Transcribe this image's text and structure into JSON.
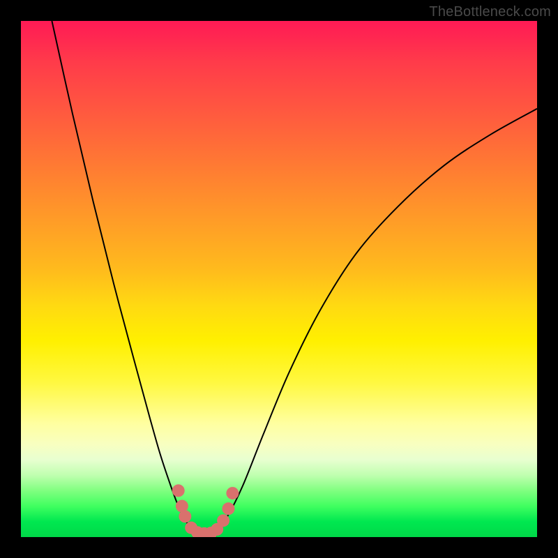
{
  "watermark": "TheBottleneck.com",
  "chart_data": {
    "type": "line",
    "title": "",
    "xlabel": "",
    "ylabel": "",
    "xlim": [
      0,
      100
    ],
    "ylim": [
      0,
      100
    ],
    "grid": false,
    "legend": false,
    "series": [
      {
        "name": "left-branch",
        "x": [
          6,
          10,
          14,
          18,
          22,
          25,
          27,
          29,
          30.5,
          32,
          33.5
        ],
        "y": [
          100,
          82,
          65,
          49,
          34,
          23,
          16,
          10,
          6,
          3,
          1.5
        ]
      },
      {
        "name": "right-branch",
        "x": [
          38,
          40,
          43,
          47,
          52,
          58,
          65,
          73,
          82,
          91,
          100
        ],
        "y": [
          1.5,
          4,
          10,
          20,
          32,
          44,
          55,
          64,
          72,
          78,
          83
        ]
      },
      {
        "name": "valley-floor",
        "x": [
          33.5,
          34.5,
          36,
          37,
          38
        ],
        "y": [
          1.5,
          0.8,
          0.6,
          0.8,
          1.5
        ]
      }
    ],
    "markers": {
      "name": "highlight-dots",
      "color": "#d9716d",
      "points": [
        {
          "x": 30.5,
          "y": 9
        },
        {
          "x": 31.2,
          "y": 6
        },
        {
          "x": 31.8,
          "y": 4
        },
        {
          "x": 33.0,
          "y": 1.8
        },
        {
          "x": 34.2,
          "y": 0.9
        },
        {
          "x": 35.5,
          "y": 0.7
        },
        {
          "x": 36.8,
          "y": 0.8
        },
        {
          "x": 38.0,
          "y": 1.5
        },
        {
          "x": 39.2,
          "y": 3.2
        },
        {
          "x": 40.2,
          "y": 5.5
        },
        {
          "x": 41.0,
          "y": 8.5
        }
      ]
    },
    "background_gradient": {
      "top": "#ff1a55",
      "mid": "#fff000",
      "bottom": "#00d848"
    }
  }
}
